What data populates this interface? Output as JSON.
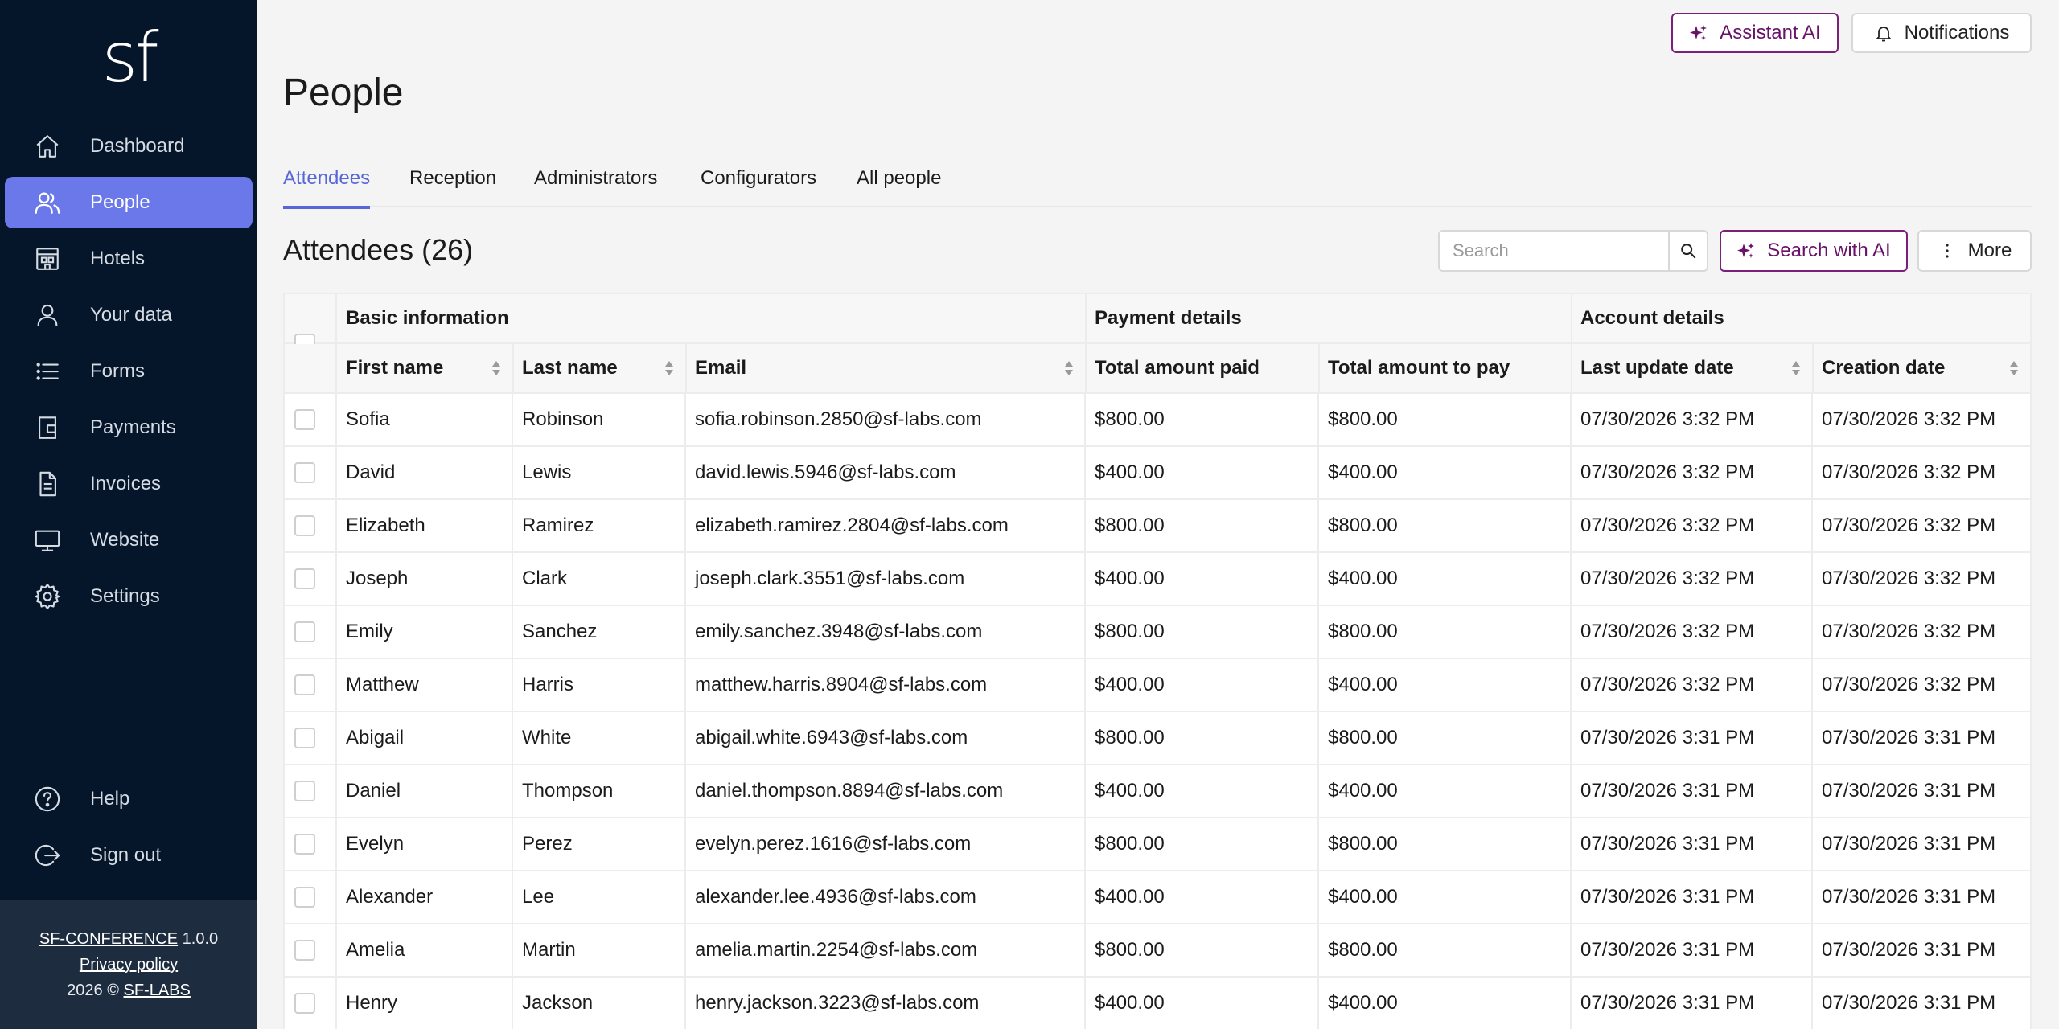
{
  "sidebar": {
    "logo": "sf",
    "items": [
      {
        "label": "Dashboard",
        "icon": "home-icon"
      },
      {
        "label": "People",
        "icon": "people-icon",
        "active": true
      },
      {
        "label": "Hotels",
        "icon": "hotel-icon"
      },
      {
        "label": "Your data",
        "icon": "user-icon"
      },
      {
        "label": "Forms",
        "icon": "list-icon"
      },
      {
        "label": "Payments",
        "icon": "wallet-icon"
      },
      {
        "label": "Invoices",
        "icon": "document-icon"
      },
      {
        "label": "Website",
        "icon": "monitor-icon"
      },
      {
        "label": "Settings",
        "icon": "gear-icon"
      }
    ],
    "bottom_items": [
      {
        "label": "Help",
        "icon": "help-icon"
      },
      {
        "label": "Sign out",
        "icon": "sign-out-icon"
      }
    ],
    "footer": {
      "app_name": "SF-CONFERENCE",
      "version": "1.0.0",
      "privacy": "Privacy policy",
      "copyright": "2026 ©",
      "company": "SF-LABS"
    }
  },
  "header": {
    "assistant_label": "Assistant AI",
    "notifications_label": "Notifications"
  },
  "page": {
    "title": "People",
    "tabs": [
      "Attendees",
      "Reception",
      "Administrators",
      "Configurators",
      "All people"
    ],
    "active_tab": "Attendees",
    "section_title": "Attendees (26)"
  },
  "search": {
    "placeholder": "Search",
    "ai_label": "Search with AI",
    "more_label": "More"
  },
  "table": {
    "groups": [
      "Basic information",
      "Payment details",
      "Account details"
    ],
    "columns": [
      "First name",
      "Last name",
      "Email",
      "Total amount paid",
      "Total amount to pay",
      "Last update date",
      "Creation date"
    ],
    "rows": [
      [
        "Sofia",
        "Robinson",
        "sofia.robinson.2850@sf-labs.com",
        "$800.00",
        "$800.00",
        "07/30/2026 3:32 PM",
        "07/30/2026 3:32 PM"
      ],
      [
        "David",
        "Lewis",
        "david.lewis.5946@sf-labs.com",
        "$400.00",
        "$400.00",
        "07/30/2026 3:32 PM",
        "07/30/2026 3:32 PM"
      ],
      [
        "Elizabeth",
        "Ramirez",
        "elizabeth.ramirez.2804@sf-labs.com",
        "$800.00",
        "$800.00",
        "07/30/2026 3:32 PM",
        "07/30/2026 3:32 PM"
      ],
      [
        "Joseph",
        "Clark",
        "joseph.clark.3551@sf-labs.com",
        "$400.00",
        "$400.00",
        "07/30/2026 3:32 PM",
        "07/30/2026 3:32 PM"
      ],
      [
        "Emily",
        "Sanchez",
        "emily.sanchez.3948@sf-labs.com",
        "$800.00",
        "$800.00",
        "07/30/2026 3:32 PM",
        "07/30/2026 3:32 PM"
      ],
      [
        "Matthew",
        "Harris",
        "matthew.harris.8904@sf-labs.com",
        "$400.00",
        "$400.00",
        "07/30/2026 3:32 PM",
        "07/30/2026 3:32 PM"
      ],
      [
        "Abigail",
        "White",
        "abigail.white.6943@sf-labs.com",
        "$800.00",
        "$800.00",
        "07/30/2026 3:31 PM",
        "07/30/2026 3:31 PM"
      ],
      [
        "Daniel",
        "Thompson",
        "daniel.thompson.8894@sf-labs.com",
        "$400.00",
        "$400.00",
        "07/30/2026 3:31 PM",
        "07/30/2026 3:31 PM"
      ],
      [
        "Evelyn",
        "Perez",
        "evelyn.perez.1616@sf-labs.com",
        "$800.00",
        "$800.00",
        "07/30/2026 3:31 PM",
        "07/30/2026 3:31 PM"
      ],
      [
        "Alexander",
        "Lee",
        "alexander.lee.4936@sf-labs.com",
        "$400.00",
        "$400.00",
        "07/30/2026 3:31 PM",
        "07/30/2026 3:31 PM"
      ],
      [
        "Amelia",
        "Martin",
        "amelia.martin.2254@sf-labs.com",
        "$800.00",
        "$800.00",
        "07/30/2026 3:31 PM",
        "07/30/2026 3:31 PM"
      ],
      [
        "Henry",
        "Jackson",
        "henry.jackson.3223@sf-labs.com",
        "$400.00",
        "$400.00",
        "07/30/2026 3:31 PM",
        "07/30/2026 3:31 PM"
      ]
    ]
  },
  "colors": {
    "sidebar_bg": "#05162b",
    "active_nav": "#6b78ea",
    "accent": "#5667d8",
    "ai_accent": "#7b1f7a"
  }
}
